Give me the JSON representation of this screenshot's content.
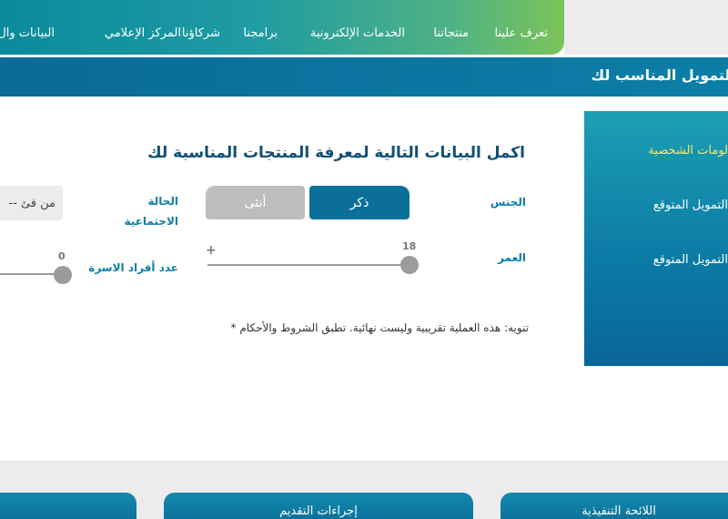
{
  "nav": {
    "items": [
      "تعرف علينا",
      "منتجاتنا",
      "الخدمات الإلكترونية",
      "برامجنا",
      "شركاؤنا",
      "المركز الإعلامي",
      "البيانات وال"
    ]
  },
  "titlebar": {
    "title": "التمويل المناسب لك"
  },
  "side": {
    "steps": [
      "لومات الشخصية",
      "التمويل المتوقع",
      "التمويل المتوقع"
    ]
  },
  "form": {
    "heading": "اكمل البيانات التالية لمعرفة المنتجات المناسبة لك",
    "gender_label": "الجنس",
    "gender_options": {
      "male": "ذكر",
      "female": "أنثى"
    },
    "gender_selected": "male",
    "marital_label_1": "الحالة",
    "marital_label_2": "الاجتماعية",
    "marital_value": "-- من فئ",
    "age_label": "العمر",
    "age_min": "18",
    "age_max": "+",
    "family_label": "عدد أفراد الاسرة",
    "family_value": "0",
    "note": "* تنويه: هذه العملية تقريبية وليست نهائية. تطبق الشروط والأحكام"
  },
  "bottom": {
    "cards": [
      "اللائحة التنفيذية",
      "إجراءات التقديم",
      ""
    ]
  },
  "colors": {
    "brand_dark": "#0b6f99",
    "brand_light": "#1b9fb3",
    "active_step": "#f4e86a"
  }
}
